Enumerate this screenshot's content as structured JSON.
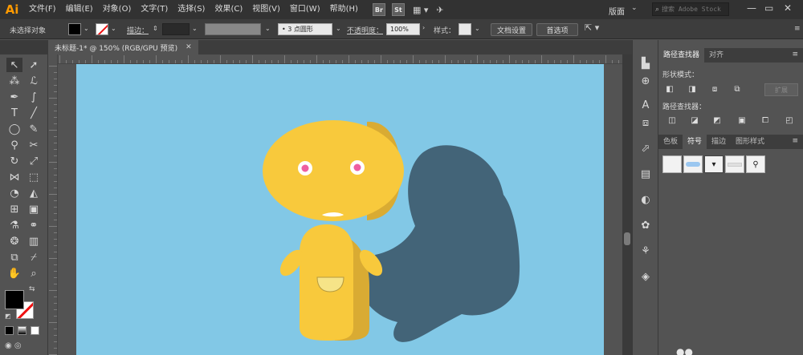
{
  "app": {
    "logo": "Ai"
  },
  "menu": {
    "items": [
      "文件(F)",
      "编辑(E)",
      "对象(O)",
      "文字(T)",
      "选择(S)",
      "效果(C)",
      "视图(V)",
      "窗口(W)",
      "帮助(H)"
    ],
    "bridge": "Br",
    "stock": "St",
    "workspace": "版面",
    "search_placeholder": "搜索 Adobe Stock"
  },
  "control": {
    "selection": "未选择对象",
    "stroke_label": "描边：",
    "brush": "3 点圆形",
    "opacity_label": "不透明度：",
    "opacity_value": "100%",
    "style_label": "样式：",
    "doc_settings": "文档设置",
    "prefs": "首选项"
  },
  "document": {
    "tab_title": "未标题-1* @ 150% (RGB/GPU 预览)"
  },
  "panels": {
    "top_tabs": [
      "路径查找器",
      "对齐"
    ],
    "shape_modes_label": "形状模式：",
    "pathfinders_label": "路径查找器：",
    "expand": "扩展",
    "bottom_tabs": [
      "色板",
      "符号",
      "描边",
      "图形样式"
    ]
  },
  "colors": {
    "artboard": "#82c8e6",
    "character_yellow": "#f8c93c",
    "character_shade": "#d9ab33",
    "shadow": "#436478",
    "accent": "#ff9a00"
  },
  "icons": {
    "tools": [
      "selection-arrow",
      "direct-selection-arrow",
      "magic-wand",
      "lasso",
      "pen",
      "curvature",
      "type",
      "line-segment",
      "ellipse",
      "paintbrush",
      "shaper",
      "scissors",
      "rotate",
      "scale",
      "width",
      "free-transform",
      "shape-builder",
      "perspective-grid",
      "mesh",
      "gradient",
      "eyedropper",
      "blend",
      "symbol-sprayer",
      "column-graph",
      "artboard",
      "slice",
      "hand",
      "zoom"
    ],
    "dock": [
      "color-guide",
      "appearance",
      "character",
      "transform",
      "gradient",
      "transparency",
      "brushes",
      "symbols",
      "graphic-styles",
      "layers"
    ]
  }
}
